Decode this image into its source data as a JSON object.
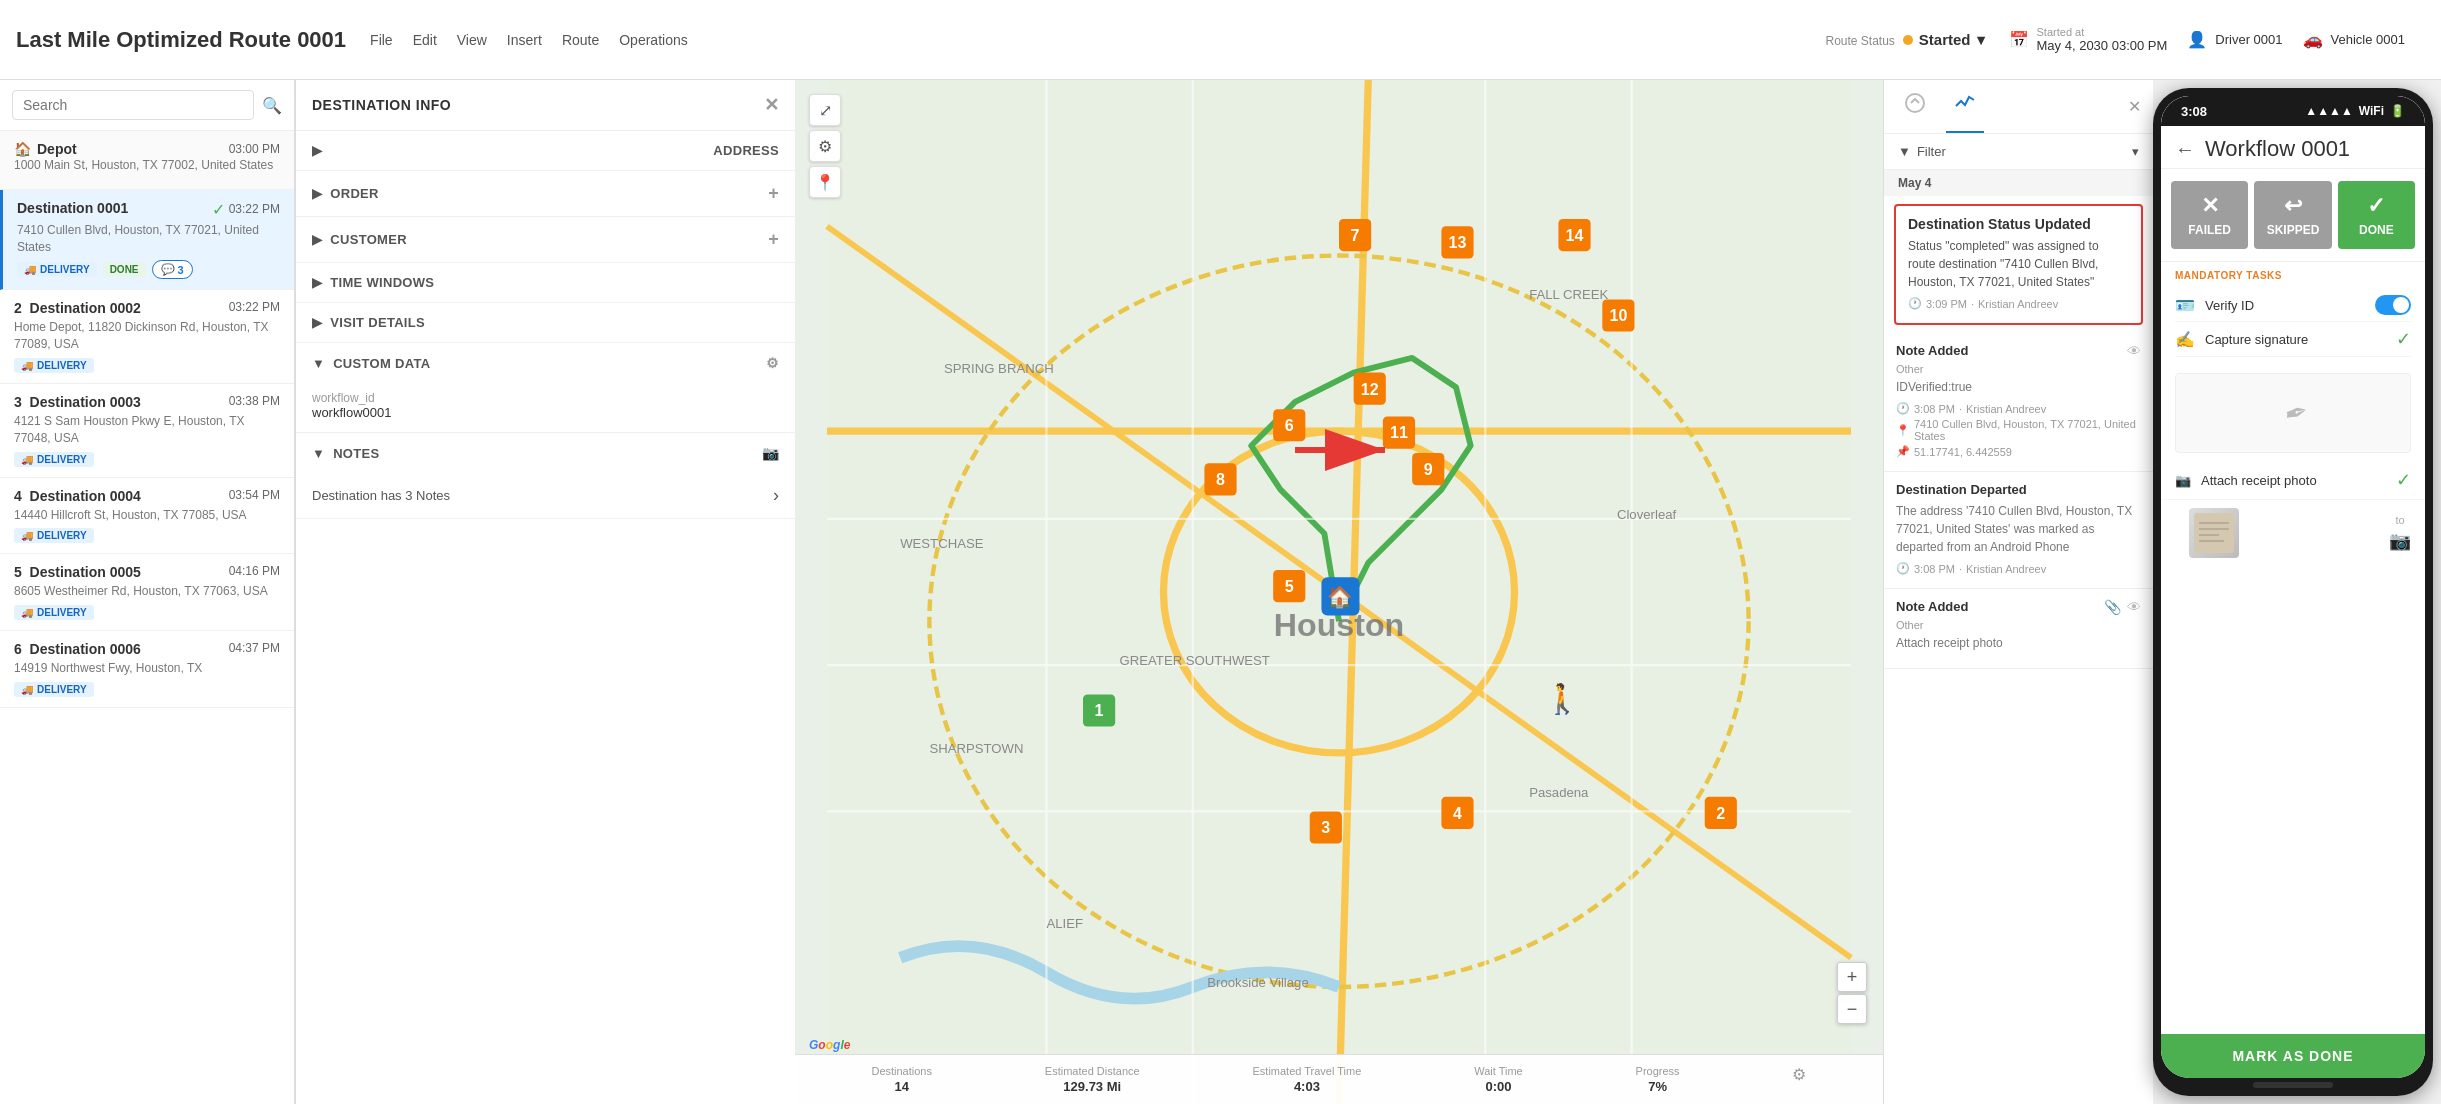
{
  "app": {
    "title": "Last Mile Optimized Route 0001",
    "menu": [
      "File",
      "Edit",
      "View",
      "Insert",
      "Route",
      "Operations"
    ]
  },
  "header": {
    "route_status_label": "Route Status",
    "route_status": "Started",
    "started_at_label": "Started at",
    "started_at": "May 4, 2030 03:00 PM",
    "driver_label": "Driver 0001",
    "vehicle_label": "Vehicle 0001"
  },
  "search": {
    "placeholder": "Search"
  },
  "depot": {
    "name": "Depot",
    "address": "1000 Main St, Houston, TX 77002, United States",
    "time": "03:00 PM"
  },
  "destinations": [
    {
      "id": 1,
      "name": "Destination 0001",
      "address": "7410 Cullen Blvd, Houston, TX 77021, United States",
      "time": "03:22 PM",
      "tags": [
        "DELIVERY"
      ],
      "status": "DONE",
      "notes": 3,
      "active": true
    },
    {
      "id": 2,
      "name": "Destination 0002",
      "address": "Home Depot, 11820 Dickinson Rd, Houston, TX 77089, USA",
      "time": "03:22 PM",
      "tags": [
        "DELIVERY"
      ],
      "status": ""
    },
    {
      "id": 3,
      "name": "Destination 0003",
      "address": "4121 S Sam Houston Pkwy E, Houston, TX 77048, USA",
      "time": "03:38 PM",
      "tags": [
        "DELIVERY"
      ],
      "status": ""
    },
    {
      "id": 4,
      "name": "Destination 0004",
      "address": "14440 Hillcroft St, Houston, TX 77085, USA",
      "time": "03:54 PM",
      "tags": [
        "DELIVERY"
      ],
      "status": ""
    },
    {
      "id": 5,
      "name": "Destination 0005",
      "address": "8605 Westheimer Rd, Houston, TX 77063, USA",
      "time": "04:16 PM",
      "tags": [
        "DELIVERY"
      ],
      "status": ""
    },
    {
      "id": 6,
      "name": "Destination 0006",
      "address": "14919 Northwest Fwy, Houston, TX",
      "time": "04:37 PM",
      "tags": [
        "DELIVERY"
      ],
      "status": ""
    }
  ],
  "dest_info": {
    "title": "DESTINATION INFO",
    "sections": {
      "address": "ADDRESS",
      "order": "ORDER",
      "customer": "CUSTOMER",
      "time_windows": "TIME WINDOWS",
      "visit_details": "VISIT DETAILS",
      "custom_data": "CUSTOM DATA",
      "custom_data_key": "workflow_id",
      "custom_data_val": "workflow0001",
      "notes": "NOTES",
      "notes_text": "Destination has 3 Notes"
    }
  },
  "activity": {
    "filter_label": "Filter",
    "date_label": "May 4",
    "items": [
      {
        "title": "Destination Status Updated",
        "body": "Status \"completed\" was assigned to route destination \"7410 Cullen Blvd, Houston, TX 77021, United States\"",
        "time": "3:09 PM",
        "user": "Kristian Andreev",
        "highlighted": true
      },
      {
        "title": "Note Added",
        "subtitle": "Other",
        "body": "IDVerified:true",
        "time": "3:08 PM",
        "user": "Kristian Andreev",
        "address": "7410 Cullen Blvd, Houston, TX 77021, United States",
        "coords": "51.17741, 6.442559",
        "highlighted": false
      },
      {
        "title": "Destination Departed",
        "body": "The address '7410 Cullen Blvd, Houston, TX 77021, United States' was marked as departed from an Android Phone",
        "time": "3:08 PM",
        "user": "Kristian Andreev",
        "highlighted": false
      },
      {
        "title": "Note Added",
        "subtitle": "Other",
        "body": "Attach receipt photo",
        "time": "",
        "user": "",
        "highlighted": false,
        "has_attachment": true
      }
    ]
  },
  "bottom_bar": {
    "destinations_label": "Destinations",
    "destinations_val": "14",
    "distance_label": "Estimated Distance",
    "distance_val": "129.73 Mi",
    "travel_time_label": "Estimated Travel Time",
    "travel_time_val": "4:03",
    "wait_time_label": "Wait Time",
    "wait_time_val": "0:00",
    "progress_label": "Progress",
    "progress_val": "7%"
  },
  "mobile": {
    "time": "3:08",
    "title": "Workflow 0001",
    "buttons": {
      "failed": "FAILED",
      "skipped": "SKIPPED",
      "done": "DONE"
    },
    "mandatory_label": "MANDATORY TASKS",
    "tasks": [
      {
        "name": "Verify ID",
        "icon": "id",
        "status": "toggle"
      },
      {
        "name": "Capture signature",
        "icon": "sign",
        "status": "check"
      }
    ],
    "attach_label": "Attach receipt photo",
    "mark_done": "MARK AS DONE"
  },
  "map": {
    "tools": [
      "expand",
      "settings",
      "pin"
    ],
    "zoom_in": "+",
    "zoom_out": "−"
  }
}
